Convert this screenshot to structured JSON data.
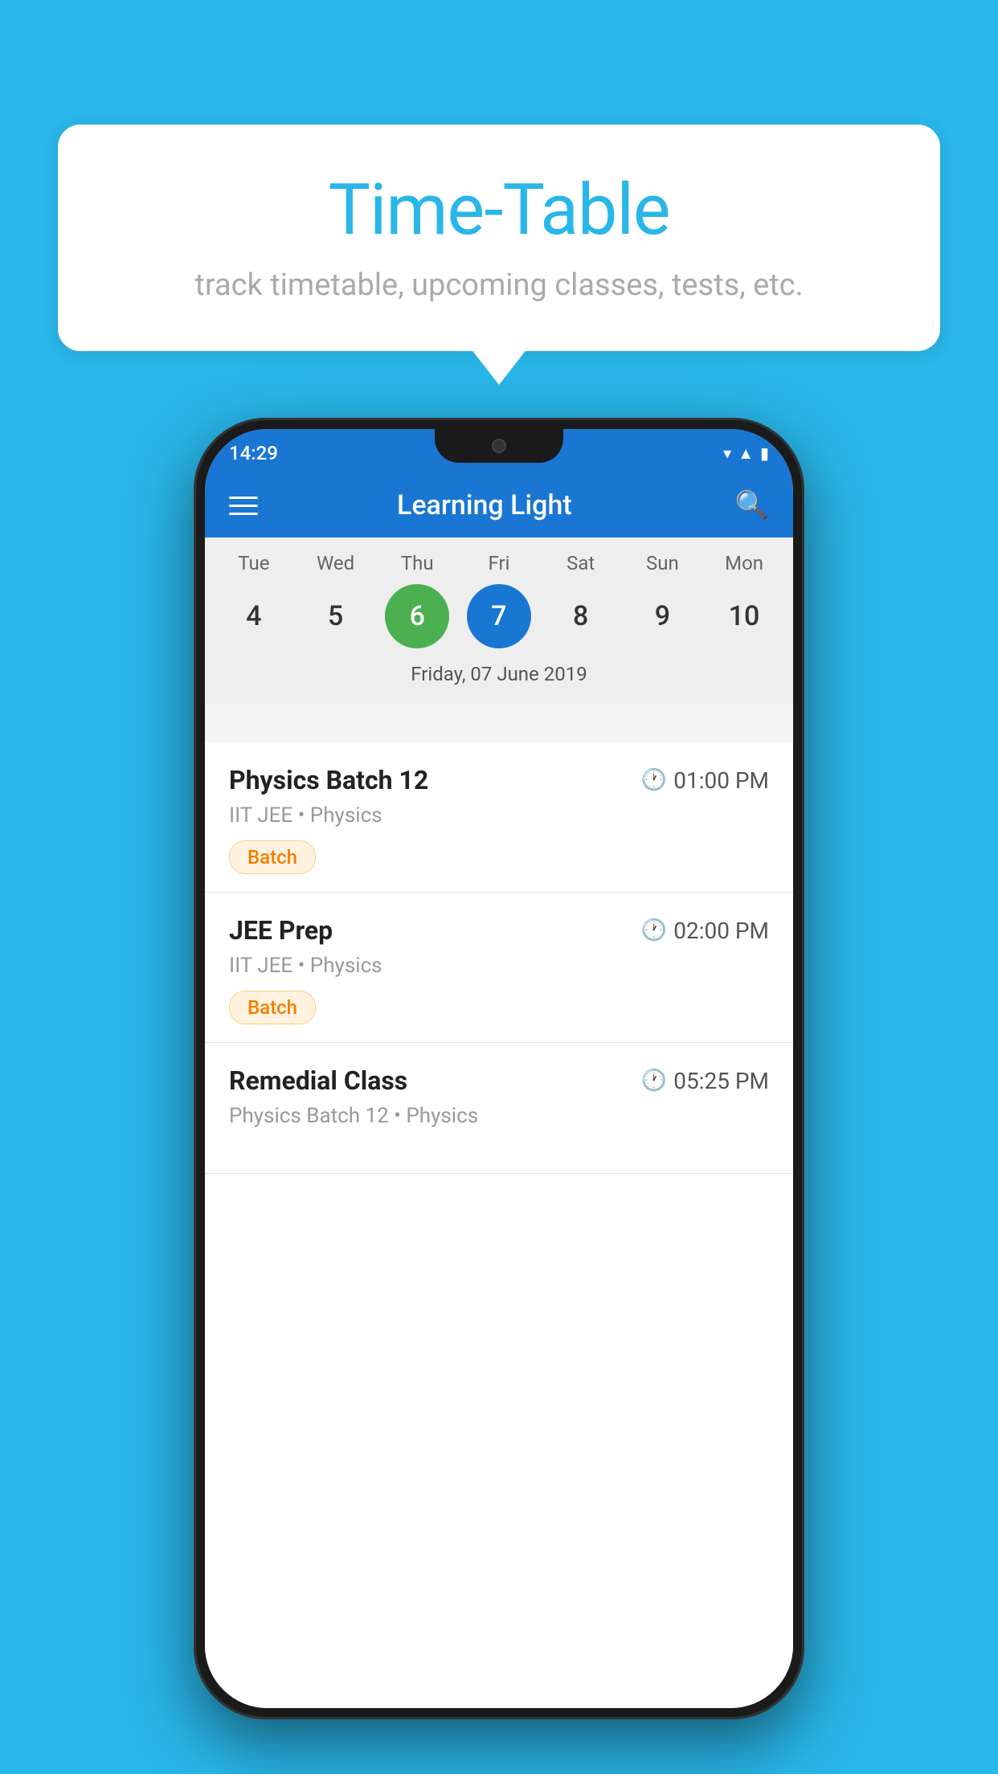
{
  "background": {
    "color": "#29b6e8"
  },
  "speech_bubble": {
    "title": "Time-Table",
    "subtitle": "track timetable, upcoming classes, tests, etc."
  },
  "phone": {
    "status_bar": {
      "time": "14:29"
    },
    "app_bar": {
      "title": "Learning Light"
    },
    "calendar": {
      "days": [
        {
          "label": "Tue",
          "number": "4"
        },
        {
          "label": "Wed",
          "number": "5"
        },
        {
          "label": "Thu",
          "number": "6",
          "state": "today"
        },
        {
          "label": "Fri",
          "number": "7",
          "state": "selected"
        },
        {
          "label": "Sat",
          "number": "8"
        },
        {
          "label": "Sun",
          "number": "9"
        },
        {
          "label": "Mon",
          "number": "10"
        }
      ],
      "selected_date_label": "Friday, 07 June 2019"
    },
    "events": [
      {
        "title": "Physics Batch 12",
        "time": "01:00 PM",
        "meta": "IIT JEE • Physics",
        "tag": "Batch"
      },
      {
        "title": "JEE Prep",
        "time": "02:00 PM",
        "meta": "IIT JEE • Physics",
        "tag": "Batch"
      },
      {
        "title": "Remedial Class",
        "time": "05:25 PM",
        "meta": "Physics Batch 12 • Physics",
        "tag": ""
      }
    ]
  }
}
